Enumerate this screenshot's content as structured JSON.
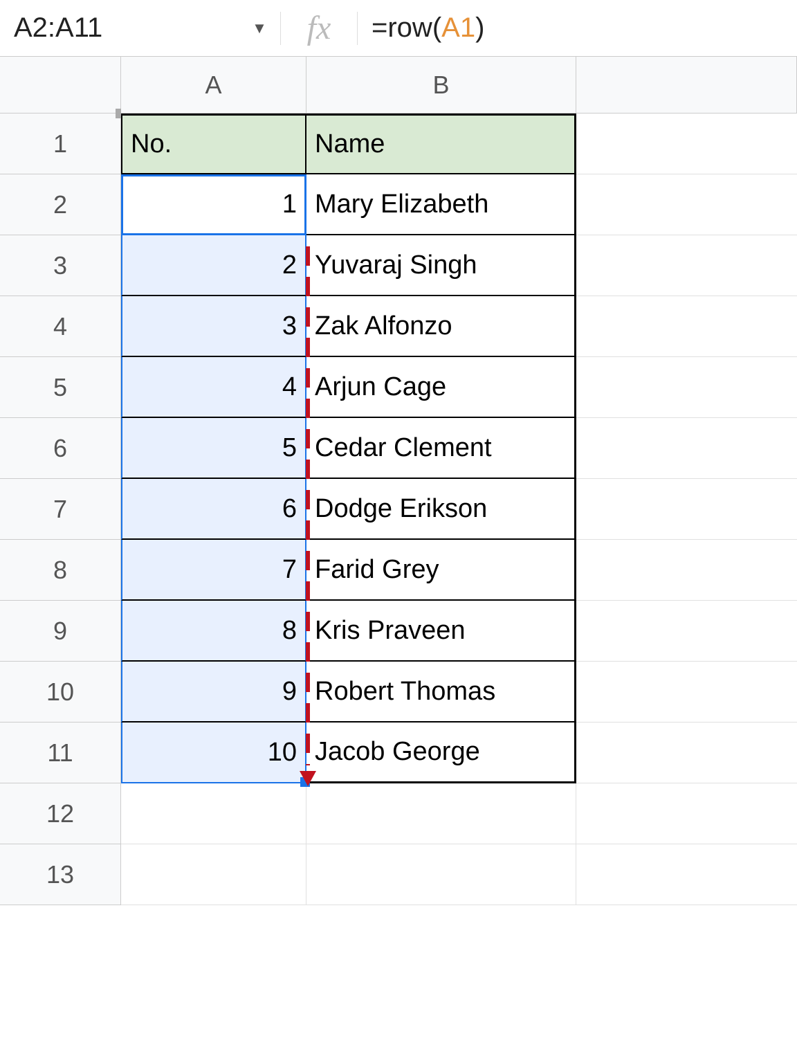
{
  "formula_bar": {
    "name_box": "A2:A11",
    "fx": "fx",
    "formula_prefix": "=row(",
    "formula_ref": "A1",
    "formula_suffix": ")"
  },
  "columns": [
    "A",
    "B"
  ],
  "rows": [
    "1",
    "2",
    "3",
    "4",
    "5",
    "6",
    "7",
    "8",
    "9",
    "10",
    "11",
    "12",
    "13"
  ],
  "header_row": {
    "A": "No.",
    "B": "Name"
  },
  "data": [
    {
      "no": "1",
      "name": "Mary Elizabeth"
    },
    {
      "no": "2",
      "name": "Yuvaraj Singh"
    },
    {
      "no": "3",
      "name": "Zak Alfonzo"
    },
    {
      "no": "4",
      "name": "Arjun Cage"
    },
    {
      "no": "5",
      "name": "Cedar Clement"
    },
    {
      "no": "6",
      "name": "Dodge Erikson"
    },
    {
      "no": "7",
      "name": "Farid Grey"
    },
    {
      "no": "8",
      "name": "Kris Praveen"
    },
    {
      "no": "9",
      "name": "Robert Thomas"
    },
    {
      "no": "10",
      "name": "Jacob George"
    }
  ],
  "selection": {
    "range": "A2:A11",
    "active": "A2"
  },
  "annotation": {
    "type": "vertical-dashed-arrow",
    "color": "#c1121f"
  }
}
